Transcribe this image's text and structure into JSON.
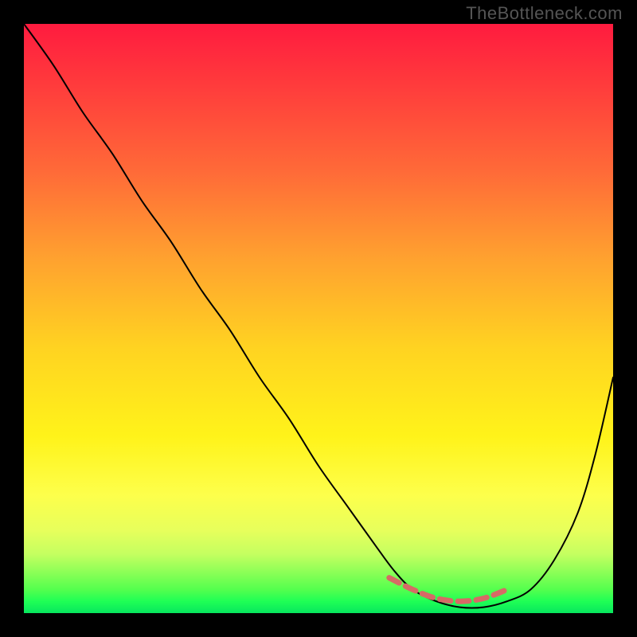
{
  "watermark": "TheBottleneck.com",
  "chart_data": {
    "type": "line",
    "title": "",
    "xlabel": "",
    "ylabel": "",
    "x_range": [
      0,
      100
    ],
    "y_range": [
      0,
      100
    ],
    "grid": false,
    "legend": false,
    "series": [
      {
        "name": "bottleneck-curve",
        "color": "#000000",
        "stroke_width": 2,
        "x": [
          0,
          5,
          10,
          15,
          20,
          25,
          30,
          35,
          40,
          45,
          50,
          55,
          60,
          63,
          66,
          70,
          74,
          78,
          82,
          86,
          90,
          94,
          97,
          100
        ],
        "y": [
          100,
          93,
          85,
          78,
          70,
          63,
          55,
          48,
          40,
          33,
          25,
          18,
          11,
          7,
          4,
          2,
          1,
          1,
          2,
          4,
          9,
          17,
          27,
          40
        ]
      },
      {
        "name": "optimal-band-marker",
        "color": "#d66a65",
        "stroke_width": 7,
        "dash": "14 9",
        "x": [
          62,
          66,
          70,
          74,
          78,
          82
        ],
        "y": [
          6,
          4,
          2.5,
          2,
          2.5,
          4
        ]
      }
    ],
    "background_gradient": {
      "direction": "vertical",
      "stops": [
        {
          "pos": 0.0,
          "color": "#ff1b3f"
        },
        {
          "pos": 0.25,
          "color": "#ff6a38"
        },
        {
          "pos": 0.55,
          "color": "#ffd321"
        },
        {
          "pos": 0.8,
          "color": "#fdff4b"
        },
        {
          "pos": 0.93,
          "color": "#8dff57"
        },
        {
          "pos": 1.0,
          "color": "#07e65e"
        }
      ]
    }
  }
}
